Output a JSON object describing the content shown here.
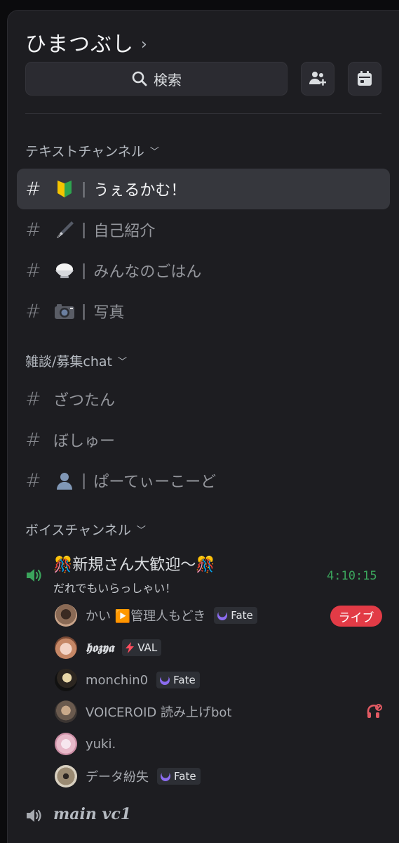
{
  "server": {
    "name": "ひまつぶし",
    "chevron": "›"
  },
  "search": {
    "label": "検索"
  },
  "toolbar": {
    "invite_icon": "add-member-icon",
    "events_icon": "calendar-icon"
  },
  "categories": {
    "text": {
      "label": "テキストチャンネル"
    },
    "chat": {
      "label": "雑談/募集chat"
    },
    "voice": {
      "label": "ボイスチャンネル"
    }
  },
  "channels": [
    {
      "hash": "#",
      "emoji": "🔰",
      "sep": "|",
      "name": "うぇるかむ！",
      "active": true
    },
    {
      "hash": "#",
      "emoji": "🖋",
      "sep": "|",
      "name": "自己紹介"
    },
    {
      "hash": "#",
      "emoji": "🍚",
      "sep": "|",
      "name": "みんなのごはん"
    },
    {
      "hash": "#",
      "emoji": "📷",
      "sep": "|",
      "name": "写真"
    },
    {
      "hash": "#",
      "name": "ざつたん"
    },
    {
      "hash": "#",
      "name": "ぼしゅー"
    },
    {
      "hash": "#",
      "emoji": "👤",
      "sep": "|",
      "name": "ぱーてぃーこーど"
    }
  ],
  "voice": {
    "active_channel": {
      "name": "🎊新規さん大歓迎〜🎊",
      "subtitle": "だれでもいらっしゃい！",
      "timer": "4:10:15"
    },
    "members": [
      {
        "name": "かい ▶️管理人もどき",
        "tag": "Fate",
        "live": "ライブ"
      },
      {
        "name": "𝖍𝖔𝖟𝖞𝖆",
        "tag": "VAL"
      },
      {
        "name": "monchin0",
        "tag": "Fate"
      },
      {
        "name": "VOICEROID 読み上げbot",
        "status_icon": "deafened-icon"
      },
      {
        "name": "yuki."
      },
      {
        "name": "データ紛失",
        "tag": "Fate"
      }
    ],
    "next_channel": {
      "name": "𝒎𝒂𝒊𝒏 𝒗𝒄1"
    }
  },
  "colors": {
    "accent_green": "#3ba55c",
    "live_red": "#e23b46",
    "fate_purple": "#8c6cf0"
  }
}
